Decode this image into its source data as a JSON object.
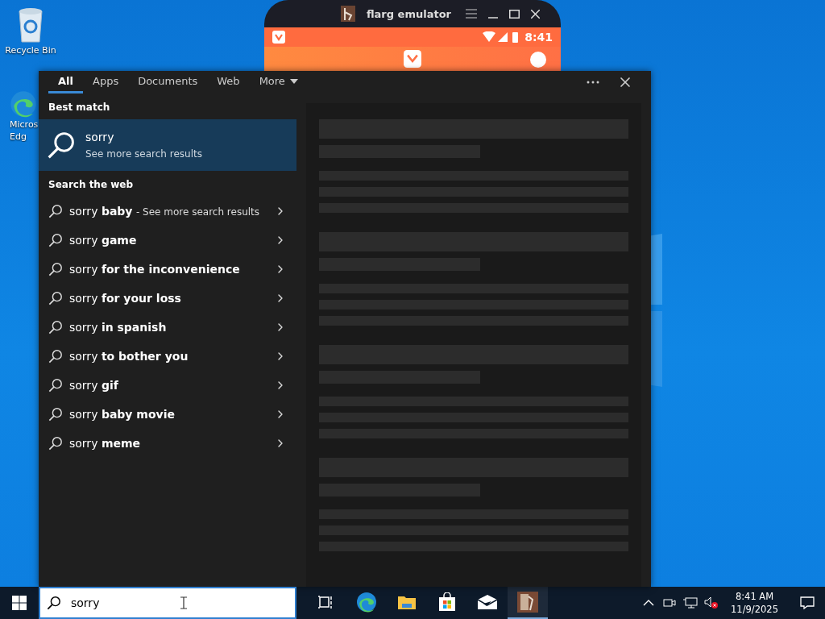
{
  "desktop_icons": [
    {
      "kind": "recycle",
      "label": "Recycle Bin"
    },
    {
      "kind": "edge",
      "label": "Micros",
      "label_2": "Edg"
    }
  ],
  "emulator": {
    "title": "flarg emulator",
    "time": "8:41"
  },
  "search_panel": {
    "tabs": [
      {
        "label": "All",
        "selected": true,
        "dropdown": false
      },
      {
        "label": "Apps",
        "selected": false,
        "dropdown": false
      },
      {
        "label": "Documents",
        "selected": false,
        "dropdown": false
      },
      {
        "label": "Web",
        "selected": false,
        "dropdown": false
      },
      {
        "label": "More",
        "selected": false,
        "dropdown": true
      }
    ],
    "best_match_heading": "Best match",
    "best_match": {
      "title": "sorry",
      "subtitle": "See more search results",
      "selected": true
    },
    "web_heading": "Search the web",
    "suggestions": [
      {
        "text": "sorry **baby**",
        "note": "- See more search results"
      },
      {
        "text": "sorry **game**"
      },
      {
        "text": "sorry **for the inconvenience**"
      },
      {
        "text": "sorry **for your loss**"
      },
      {
        "text": "sorry **in spanish**"
      },
      {
        "text": "sorry **to bother you**"
      },
      {
        "text": "sorry **gif**"
      },
      {
        "text": "sorry **baby movie**"
      },
      {
        "text": "sorry **meme**"
      }
    ]
  },
  "taskbar": {
    "search_value": "sorry",
    "apps": [
      {
        "kind": "taskview",
        "active": false
      },
      {
        "kind": "edge",
        "active": false
      },
      {
        "kind": "explorer",
        "active": false
      },
      {
        "kind": "store",
        "active": false
      },
      {
        "kind": "mail",
        "active": false
      },
      {
        "kind": "emulator",
        "active": true
      }
    ],
    "time": "8:41 AM",
    "date": "11/9/2025"
  }
}
